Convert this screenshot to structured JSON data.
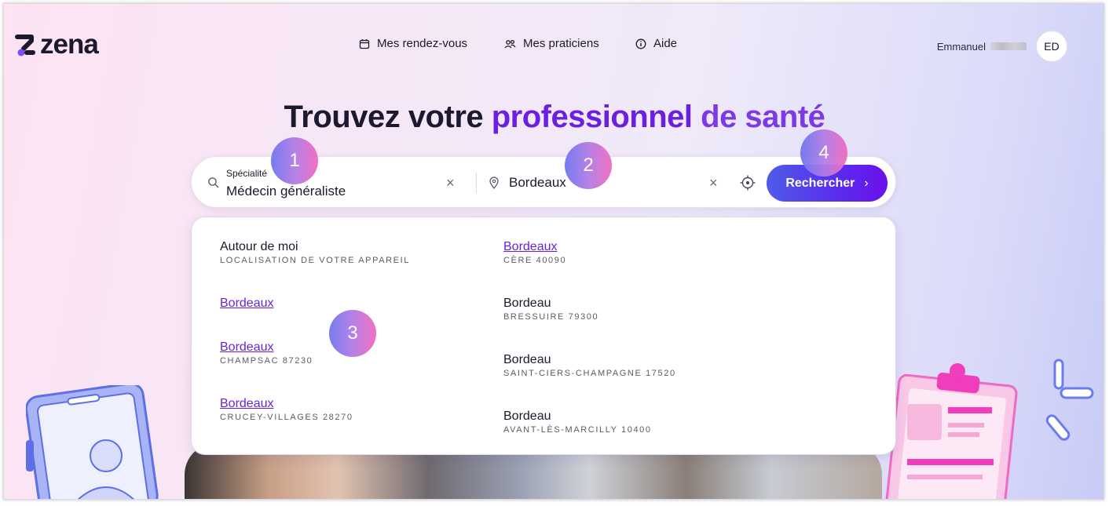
{
  "brand": {
    "name": "zena"
  },
  "nav": {
    "appointments": "Mes rendez-vous",
    "practitioners": "Mes praticiens",
    "help": "Aide"
  },
  "user": {
    "first_name": "Emmanuel",
    "initials": "ED"
  },
  "hero": {
    "title_part1": "Trouvez votre",
    "title_part2": "professionnel",
    "title_part3": "de santé"
  },
  "search": {
    "specialty_label": "Spécialité",
    "specialty_value": "Médecin généraliste",
    "clear_symbol": "×",
    "location_value": "Bordeaux",
    "button_label": "Rechercher",
    "button_chevron": "›"
  },
  "suggestions": {
    "left": [
      {
        "title": "Autour de moi",
        "subtitle": "LOCALISATION DE VOTRE APPAREIL"
      },
      {
        "title": "Bordeaux",
        "subtitle": ""
      },
      {
        "title": "Bordeaux",
        "subtitle": "CHAMPSAC 87230"
      },
      {
        "title": "Bordeaux",
        "subtitle": "CRUCEY-VILLAGES 28270"
      }
    ],
    "right": [
      {
        "title": "Bordeaux",
        "subtitle": "CÈRE 40090"
      },
      {
        "title": "Bordeau",
        "subtitle": "BRESSUIRE 79300"
      },
      {
        "title": "Bordeau",
        "subtitle": "SAINT-CIERS-CHAMPAGNE 17520"
      },
      {
        "title": "Bordeau",
        "subtitle": "AVANT-LÈS-MARCILLY 10400"
      }
    ]
  },
  "markers": [
    "1",
    "2",
    "3",
    "4"
  ],
  "colors": {
    "accent_purple": "#6a1fe0",
    "button_gradient_start": "#4f5ce8",
    "button_gradient_end": "#6a12e9",
    "text_dark": "#1c1a2a"
  },
  "icons": {
    "logo": "zena-logo-mark",
    "appointments": "calendar-icon",
    "practitioners": "people-icon",
    "help": "info-icon",
    "specialty": "search-icon",
    "location": "location-pin-icon",
    "gps": "crosshair-icon"
  }
}
